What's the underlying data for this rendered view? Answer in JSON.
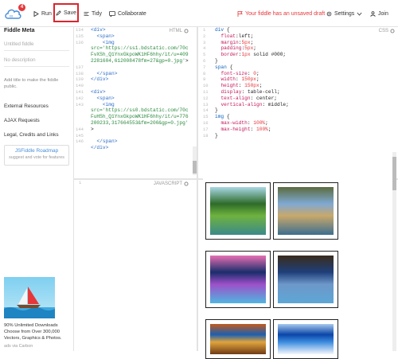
{
  "topbar": {
    "badge_count": "4",
    "run_label": "Run",
    "save_label": "Save",
    "tidy_label": "Tidy",
    "collaborate_label": "Collaborate",
    "draft_notice": "Your fiddle has an unsaved draft",
    "settings_label": "Settings",
    "join_label": "Join"
  },
  "sidebar": {
    "title": "Fiddle Meta",
    "name_placeholder": "Untitled fiddle",
    "description_placeholder": "No description",
    "title_hint": "Add title to make the fiddle public.",
    "external_resources": "External Resources",
    "ajax_requests": "AJAX Requests",
    "legal": "Legal, Credits and Links",
    "roadmap_title": "JSFiddle Roadmap",
    "roadmap_sub": "suggest and vote for features",
    "ad_text": "90% Unlimited Downloads Choose from Over 300,000 Vectors, Graphics & Photos.",
    "ad_via": "ads via Carbon"
  },
  "html_panel": {
    "label": "HTML",
    "line_numbers": [
      "134",
      "135",
      "136",
      "",
      "",
      "",
      "137",
      "138",
      "139",
      "140",
      "141",
      "142",
      "143",
      "",
      "",
      "",
      "144",
      "145",
      "146"
    ],
    "lines": [
      {
        "indent": "",
        "parts": [
          [
            "tag",
            "<div>"
          ]
        ]
      },
      {
        "indent": "  ",
        "parts": [
          [
            "tag",
            "<span>"
          ]
        ]
      },
      {
        "indent": "    ",
        "parts": [
          [
            "tag",
            "<img"
          ]
        ]
      },
      {
        "indent": "",
        "parts": [
          [
            "str",
            "src='https://ss1.bdstatic.com/70c"
          ]
        ]
      },
      {
        "indent": "",
        "parts": [
          [
            "str",
            "FvXSh_Q1YnxGkpoWK1HF6hhy/it/u=409"
          ]
        ]
      },
      {
        "indent": "",
        "parts": [
          [
            "str",
            "2281604,612008478fm=27&gp=0.jpg'"
          ]
        ],
        "suffix": ">"
      },
      {
        "indent": "",
        "parts": [
          [
            "plain",
            ""
          ]
        ]
      },
      {
        "indent": "  ",
        "parts": [
          [
            "tag",
            "</span>"
          ]
        ]
      },
      {
        "indent": "",
        "parts": [
          [
            "tag",
            "</div>"
          ]
        ]
      },
      {
        "indent": "",
        "parts": [
          [
            "plain",
            ""
          ]
        ]
      },
      {
        "indent": "",
        "parts": [
          [
            "tag",
            "<div>"
          ]
        ]
      },
      {
        "indent": "  ",
        "parts": [
          [
            "tag",
            "<span>"
          ]
        ]
      },
      {
        "indent": "    ",
        "parts": [
          [
            "tag",
            "<img"
          ]
        ]
      },
      {
        "indent": "",
        "parts": [
          [
            "str",
            "src='https://ss0.bdstatic.com/70c"
          ]
        ]
      },
      {
        "indent": "",
        "parts": [
          [
            "str",
            "FuHSh_Q1YnxGkpoWK1HF6hhy/it/u=776"
          ]
        ]
      },
      {
        "indent": "",
        "parts": [
          [
            "str",
            "200233,317664553&fm=200&gp=0.jpg'"
          ]
        ]
      },
      {
        "indent": "",
        "parts": [
          [
            "plain",
            ">"
          ]
        ]
      },
      {
        "indent": "",
        "parts": [
          [
            "plain",
            ""
          ]
        ]
      },
      {
        "indent": "  ",
        "parts": [
          [
            "tag",
            "</span>"
          ]
        ]
      },
      {
        "indent": "",
        "parts": [
          [
            "tag",
            "</div>"
          ]
        ]
      }
    ]
  },
  "css_panel": {
    "label": "CSS",
    "line_numbers": [
      "1",
      "2",
      "3",
      "4",
      "5",
      "6",
      "7",
      "8",
      "9",
      "10",
      "11",
      "12",
      "13",
      "14",
      "15",
      "16",
      "17",
      "18"
    ],
    "lines": [
      [
        [
          "sel",
          "div"
        ],
        [
          "plain",
          " {"
        ]
      ],
      [
        [
          "plain",
          "  "
        ],
        [
          "prop",
          "float"
        ],
        [
          "plain",
          ":left;"
        ]
      ],
      [
        [
          "plain",
          "  "
        ],
        [
          "prop",
          "margin"
        ],
        [
          "plain",
          ":"
        ],
        [
          "num",
          "5px"
        ],
        [
          "plain",
          ";"
        ]
      ],
      [
        [
          "plain",
          "  "
        ],
        [
          "prop",
          "padding"
        ],
        [
          "plain",
          ":"
        ],
        [
          "num",
          "5px"
        ],
        [
          "plain",
          ";"
        ]
      ],
      [
        [
          "plain",
          "  "
        ],
        [
          "prop",
          "border"
        ],
        [
          "plain",
          ":"
        ],
        [
          "num",
          "1px"
        ],
        [
          "plain",
          " solid #000;"
        ]
      ],
      [
        [
          "plain",
          "}"
        ]
      ],
      [
        [
          "sel",
          "span"
        ],
        [
          "plain",
          " {"
        ]
      ],
      [
        [
          "plain",
          "  "
        ],
        [
          "prop",
          "font-size"
        ],
        [
          "plain",
          ": "
        ],
        [
          "num",
          "0"
        ],
        [
          "plain",
          ";"
        ]
      ],
      [
        [
          "plain",
          "  "
        ],
        [
          "prop",
          "width"
        ],
        [
          "plain",
          ": "
        ],
        [
          "num",
          "150px"
        ],
        [
          "plain",
          ";"
        ]
      ],
      [
        [
          "plain",
          "  "
        ],
        [
          "prop",
          "height"
        ],
        [
          "plain",
          ": "
        ],
        [
          "num",
          "150px"
        ],
        [
          "plain",
          ";"
        ]
      ],
      [
        [
          "plain",
          "  "
        ],
        [
          "prop",
          "display"
        ],
        [
          "plain",
          ": table-cell;"
        ]
      ],
      [
        [
          "plain",
          "  "
        ],
        [
          "prop",
          "text-align"
        ],
        [
          "plain",
          ": center;"
        ]
      ],
      [
        [
          "plain",
          "  "
        ],
        [
          "prop",
          "vertical-align"
        ],
        [
          "plain",
          ": middle;"
        ]
      ],
      [
        [
          "plain",
          "}"
        ]
      ],
      [
        [
          "sel",
          "img"
        ],
        [
          "plain",
          " {"
        ]
      ],
      [
        [
          "plain",
          "  "
        ],
        [
          "prop",
          "max-width"
        ],
        [
          "plain",
          ": "
        ],
        [
          "num",
          "100%"
        ],
        [
          "plain",
          ";"
        ]
      ],
      [
        [
          "plain",
          "  "
        ],
        [
          "prop",
          "max-height"
        ],
        [
          "plain",
          ": "
        ],
        [
          "num",
          "100%"
        ],
        [
          "plain",
          ";"
        ]
      ],
      [
        [
          "plain",
          "}"
        ]
      ]
    ]
  },
  "js_panel": {
    "label": "JAVASCRIPT",
    "line_numbers": [
      "1"
    ]
  },
  "result": {
    "images": [
      {
        "name": "lake-scene-image",
        "colors": [
          "#2e6b2a",
          "#6fb23f",
          "#a9d8e6",
          "#3a8a8a"
        ]
      },
      {
        "name": "mountain-lake-image",
        "colors": [
          "#7fa9d4",
          "#c9a86a",
          "#5b6b3e",
          "#3c6e8f"
        ]
      },
      {
        "name": "purple-mountain-image",
        "colors": [
          "#1a2d6b",
          "#9d4fc8",
          "#e86fb2",
          "#4fb6e0"
        ]
      },
      {
        "name": "palace-lake-image",
        "colors": [
          "#1f3f7a",
          "#6d97c9",
          "#3a2a1a",
          "#5da7d6"
        ]
      },
      {
        "name": "autumn-field-image",
        "colors": [
          "#1c5fb0",
          "#e0a43c",
          "#c35a1c",
          "#6f3b16"
        ]
      },
      {
        "name": "blue-sky-image",
        "colors": [
          "#0a45a8",
          "#3d8de0",
          "#a8c9ee",
          "#f4f7fb"
        ]
      }
    ]
  }
}
